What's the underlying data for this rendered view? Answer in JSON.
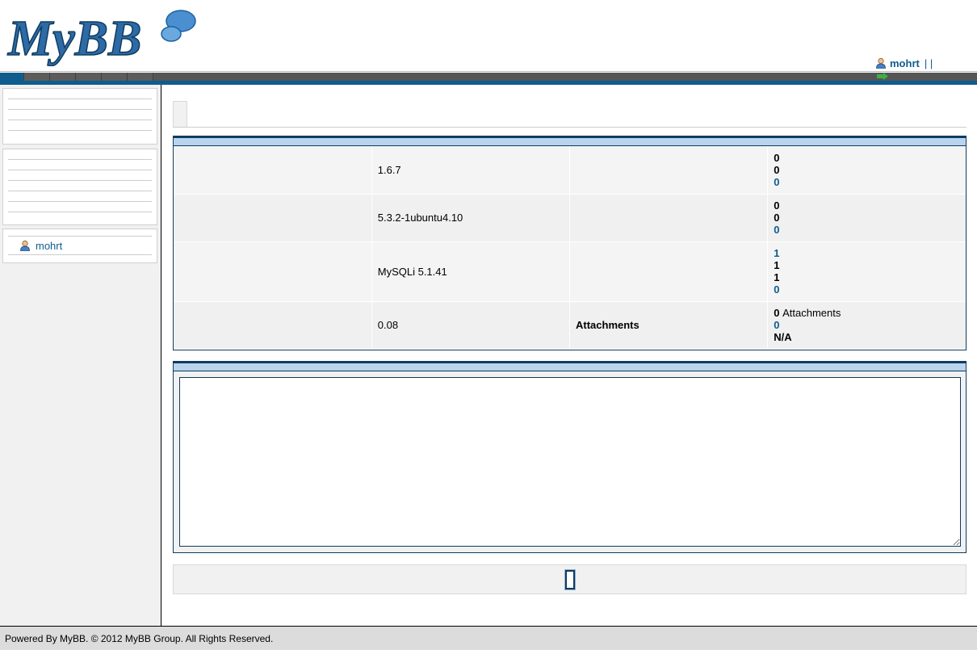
{
  "header": {
    "logo_text": "MyBB",
    "user": "mohrt",
    "separators": "| |"
  },
  "sidebar": {
    "user_item": "mohrt"
  },
  "stats_rows": [
    {
      "value": "1.6.7",
      "label": "",
      "counts": [
        "0",
        "0",
        "0"
      ]
    },
    {
      "value": "5.3.2-1ubuntu4.10",
      "label": "",
      "counts": [
        "0",
        "0",
        "0"
      ]
    },
    {
      "value": "MySQLi 5.1.41",
      "label": "",
      "counts": [
        "1",
        "1",
        "1",
        "0"
      ]
    },
    {
      "value": "0.08",
      "label": "Attachments",
      "counts": [
        "0",
        "0",
        "N/A"
      ],
      "counts_suffix": "Attachments"
    }
  ],
  "notes": {
    "value": ""
  },
  "footer": {
    "text": "Powered By MyBB. © 2012 MyBB Group. All Rights Reserved."
  },
  "colors": {
    "accent": "#0f5c8e",
    "table_head": "#b8d4ee",
    "border_dark": "#0f3c5e"
  },
  "icons": {
    "user": "user-icon",
    "logout": "logout-icon",
    "logo_bubble": "speech-bubble-icon"
  }
}
